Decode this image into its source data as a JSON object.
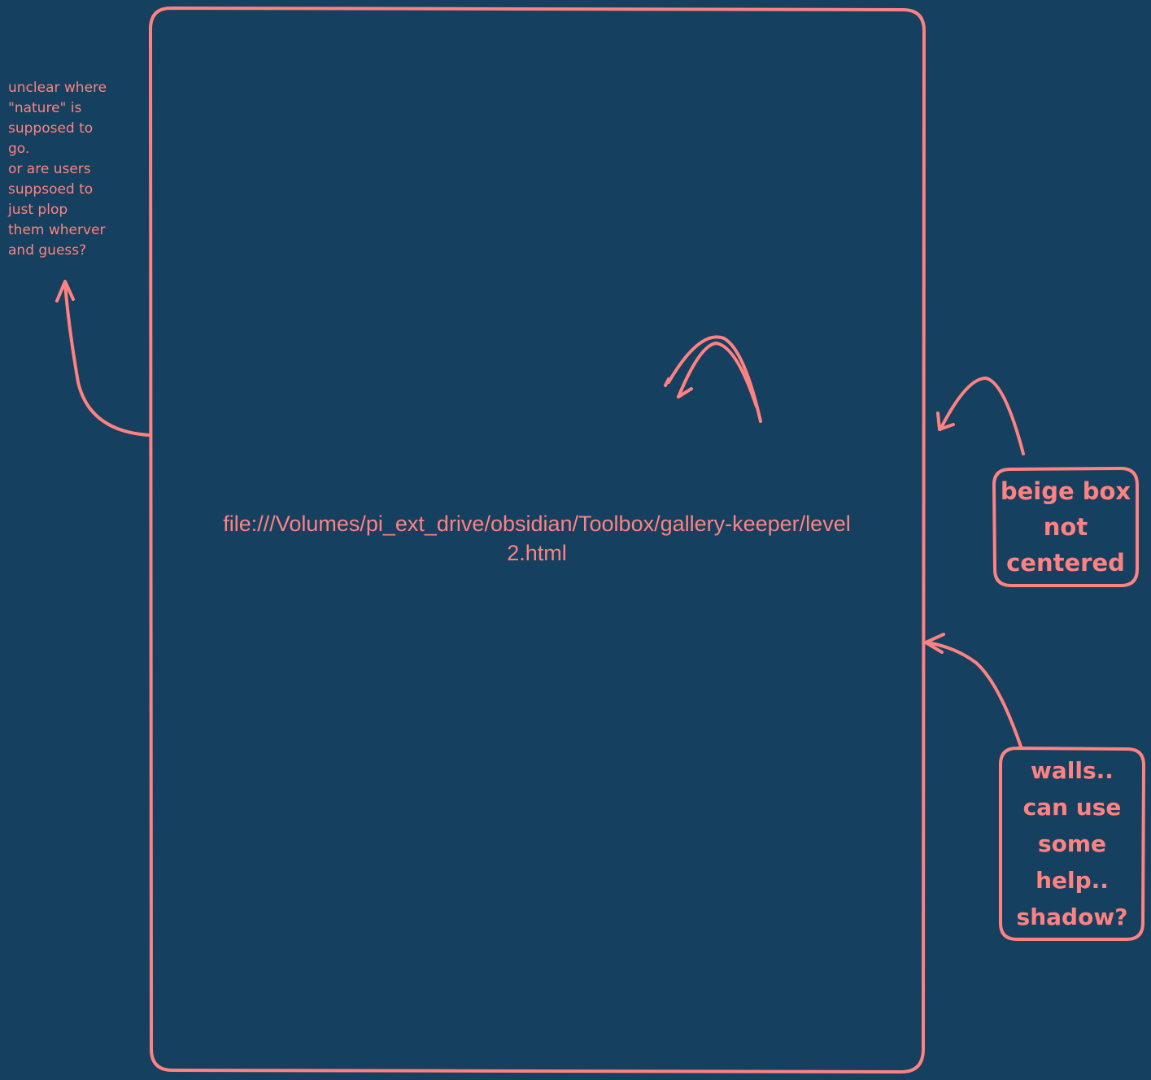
{
  "colors": {
    "background": "#16405f",
    "stroke": "#ff8282"
  },
  "notes": {
    "left": "unclear where\n\"nature\" is\nsupposed to\ngo.\nor are users\nsuppsoed to\njust plop\nthem wherver\nand guess?",
    "beige_box": "beige box\nnot\ncentered",
    "walls": "walls..\ncan use\nsome\nhelp..\nshadow?"
  },
  "embed": {
    "url": "file:///Volumes/pi_ext_drive/obsidian/Toolbox/gallery-keeper/level2.html"
  }
}
